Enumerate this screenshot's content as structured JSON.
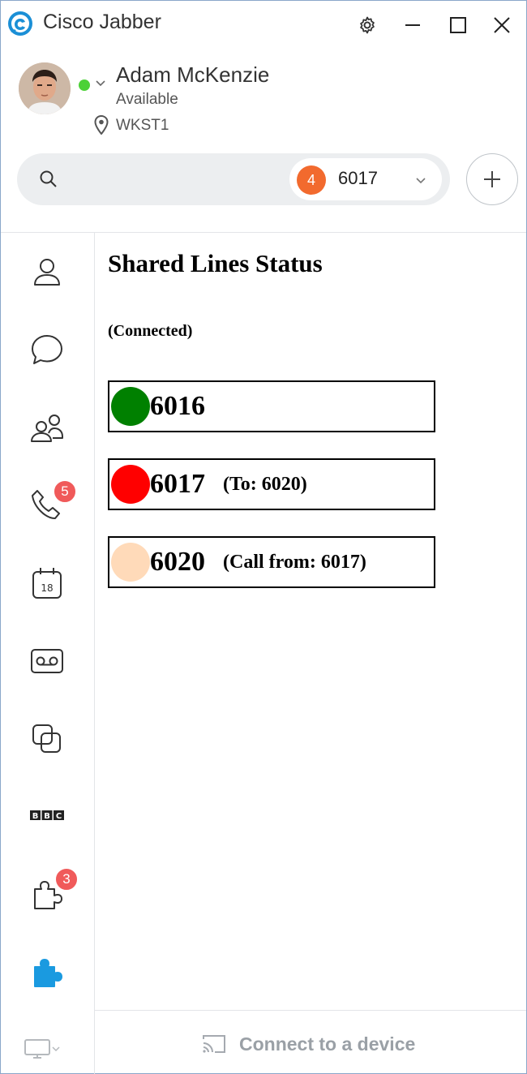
{
  "app": {
    "title": "Cisco Jabber"
  },
  "titlebar": {
    "settings_icon": "gear-icon",
    "minimize_icon": "minimize-icon",
    "maximize_icon": "maximize-icon",
    "close_icon": "close-icon"
  },
  "profile": {
    "name": "Adam McKenzie",
    "status": "Available",
    "presence_color": "#4cd137",
    "location": "WKST1"
  },
  "search": {
    "placeholder": "",
    "line_badge": "4",
    "line_number": "6017",
    "badge_color": "#f26a2e"
  },
  "nav": {
    "items": [
      {
        "name": "contacts",
        "icon": "person-icon",
        "badge": ""
      },
      {
        "name": "chats",
        "icon": "chat-bubble-icon",
        "badge": ""
      },
      {
        "name": "meetings",
        "icon": "people-icon",
        "badge": ""
      },
      {
        "name": "calls",
        "icon": "phone-icon",
        "badge": "5"
      },
      {
        "name": "calendar",
        "icon": "calendar-icon",
        "badge": ""
      },
      {
        "name": "voicemail",
        "icon": "voicemail-icon",
        "badge": ""
      },
      {
        "name": "screens",
        "icon": "overlap-squares-icon",
        "badge": ""
      },
      {
        "name": "bbc",
        "icon": "bbc-logo-icon",
        "badge": ""
      },
      {
        "name": "custom-tabs",
        "icon": "puzzle-outline-icon",
        "badge": "3"
      },
      {
        "name": "shared-lines",
        "icon": "puzzle-filled-icon",
        "badge": ""
      }
    ]
  },
  "shared_lines": {
    "title": "Shared Lines Status",
    "connection": "(Connected)",
    "lines": [
      {
        "number": "6016",
        "detail": "",
        "color": "#008000"
      },
      {
        "number": "6017",
        "detail": "(To: 6020)",
        "color": "#ff0000"
      },
      {
        "number": "6020",
        "detail": "(Call from: 6017)",
        "color": "#ffdab9"
      }
    ]
  },
  "footer": {
    "connect_label": "Connect to a device"
  }
}
